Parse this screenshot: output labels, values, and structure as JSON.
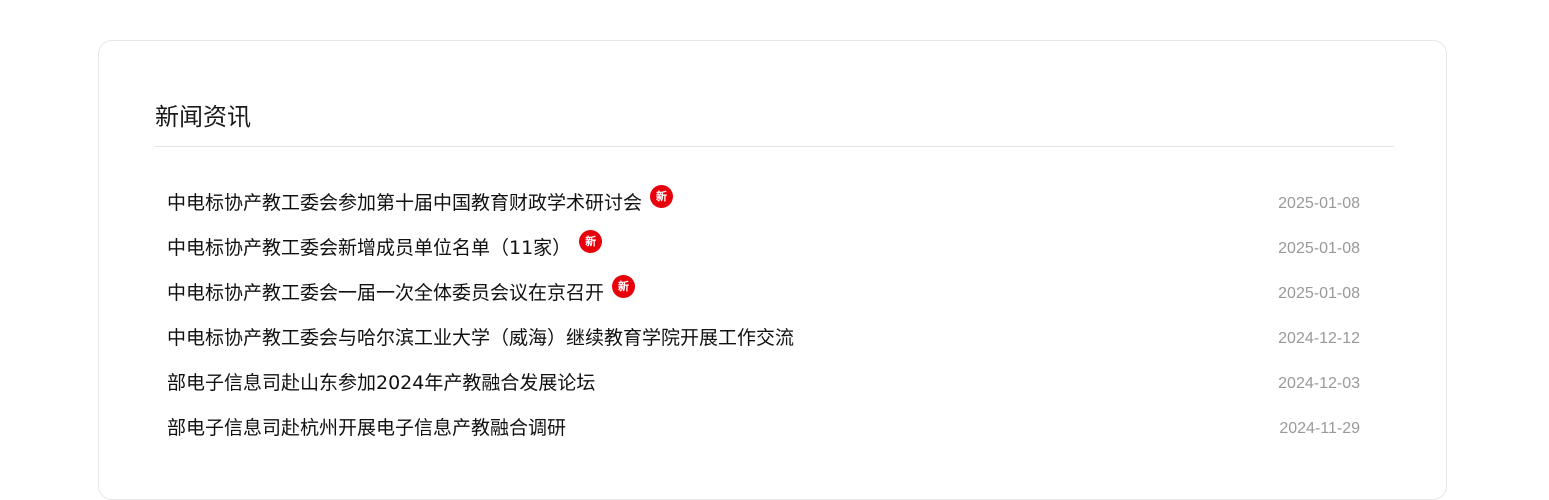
{
  "section": {
    "title": "新闻资讯"
  },
  "news": [
    {
      "title": "中电标协产教工委会参加第十届中国教育财政学术研讨会",
      "date": "2025-01-08",
      "badge": "新"
    },
    {
      "title": "中电标协产教工委会新增成员单位名单（11家）",
      "date": "2025-01-08",
      "badge": "新"
    },
    {
      "title": "中电标协产教工委会一届一次全体委员会议在京召开",
      "date": "2025-01-08",
      "badge": "新"
    },
    {
      "title": "中电标协产教工委会与哈尔滨工业大学（威海）继续教育学院开展工作交流",
      "date": "2024-12-12",
      "badge": ""
    },
    {
      "title": "部电子信息司赴山东参加2024年产教融合发展论坛",
      "date": "2024-12-03",
      "badge": ""
    },
    {
      "title": "部电子信息司赴杭州开展电子信息产教融合调研",
      "date": "2024-11-29",
      "badge": ""
    }
  ],
  "colors": {
    "badge": "#e8000b",
    "date": "#999999",
    "border": "#e6e6e6"
  }
}
